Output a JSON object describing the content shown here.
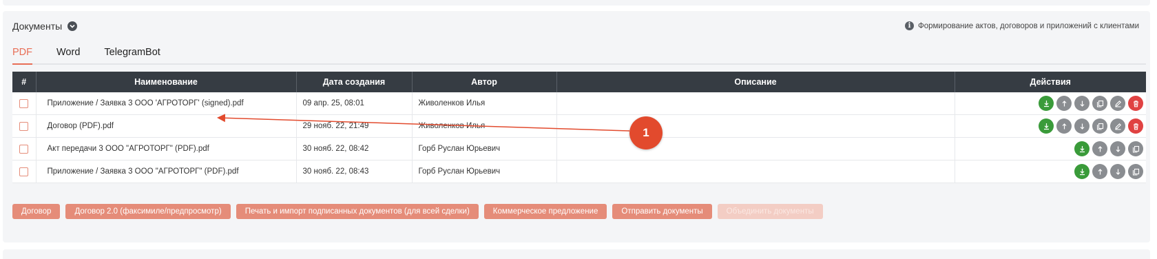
{
  "section": {
    "title": "Документы",
    "help_text": "Формирование актов, договоров и приложений с клиентами"
  },
  "tabs": [
    {
      "label": "PDF",
      "active": true
    },
    {
      "label": "Word",
      "active": false
    },
    {
      "label": "TelegramBot",
      "active": false
    }
  ],
  "table": {
    "columns": [
      "#",
      "Наименование",
      "Дата создания",
      "Автор",
      "Описание",
      "Действия"
    ],
    "rows": [
      {
        "name": "Приложение / Заявка 3 ООО 'АГРОТОРГ' (signed).pdf",
        "date": "09 апр. 25, 08:01",
        "author": "Живоленков Илья",
        "description": "",
        "actions": [
          "download-icon",
          "arrow-up-icon",
          "arrow-down-icon",
          "copy-icon",
          "edit-icon",
          "trash-icon"
        ]
      },
      {
        "name": "Договор (PDF).pdf",
        "date": "29 нояб. 22, 21:49",
        "author": "Живоленков Илья",
        "description": "",
        "actions": [
          "download-icon",
          "arrow-up-icon",
          "arrow-down-icon",
          "copy-icon",
          "edit-icon",
          "trash-icon"
        ]
      },
      {
        "name": "Акт передачи 3 ООО \"АГРОТОРГ\" (PDF).pdf",
        "date": "30 нояб. 22, 08:42",
        "author": "Горб Руслан Юрьевич",
        "description": "",
        "actions": [
          "download-icon",
          "arrow-up-icon",
          "arrow-down-icon",
          "copy-icon"
        ]
      },
      {
        "name": "Приложение / Заявка 3 ООО \"АГРОТОРГ\" (PDF).pdf",
        "date": "30 нояб. 22, 08:43",
        "author": "Горб Руслан Юрьевич",
        "description": "",
        "actions": [
          "download-icon",
          "arrow-up-icon",
          "arrow-down-icon",
          "copy-icon"
        ]
      }
    ]
  },
  "buttons": [
    {
      "label": "Договор",
      "disabled": false
    },
    {
      "label": "Договор 2.0 (факсимиле/предпросмотр)",
      "disabled": false
    },
    {
      "label": "Печать и импорт подписанных документов (для всей сделки)",
      "disabled": false
    },
    {
      "label": "Коммерческое предложение",
      "disabled": false
    },
    {
      "label": "Отправить документы",
      "disabled": false
    },
    {
      "label": "Объединить документы",
      "disabled": true
    }
  ],
  "annotation": {
    "label": "1"
  },
  "colors": {
    "accent": "#e86e56",
    "button": "#e58c79",
    "header": "#363c43",
    "green": "#3a9b3a",
    "grey": "#8a8d91",
    "red": "#e04242",
    "marker": "#e24a2d"
  }
}
